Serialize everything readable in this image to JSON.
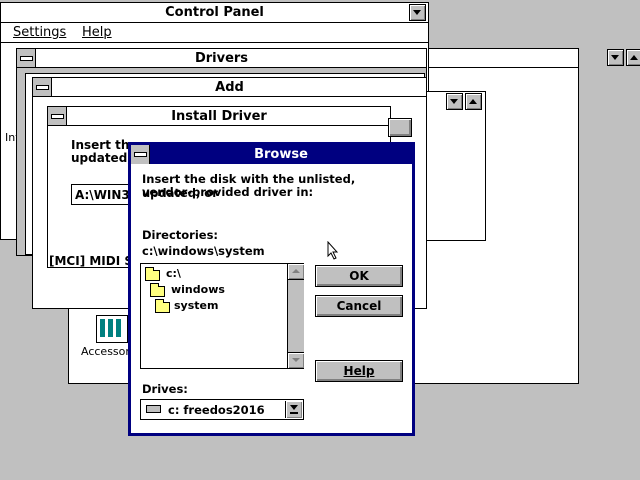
{
  "control_panel": {
    "title": "Control Panel",
    "menu": [
      "Settings",
      "Help"
    ],
    "icon_label": "Accessori",
    "left_fragment": "Int"
  },
  "drivers": {
    "title": "Drivers"
  },
  "add": {
    "title": "Add"
  },
  "install_driver": {
    "title": "Install Driver",
    "text_line1": "Insert the",
    "text_line2": "updated, o",
    "path_value": "A:\\WIN31",
    "list_fragment": "[MCI] MIDI Se"
  },
  "browse": {
    "title": "Browse",
    "instruction_line1": "Insert the disk with the unlisted, updated, or",
    "instruction_line2": "vendor-provided driver in:",
    "directories_label": "Directories:",
    "current_dir": "c:\\windows\\system",
    "directories": [
      {
        "name": "c:\\",
        "icon": "open-folder-icon"
      },
      {
        "name": "windows",
        "icon": "open-folder-icon"
      },
      {
        "name": "system",
        "icon": "open-folder-icon"
      }
    ],
    "drives_label": "Drives:",
    "drive_value": "c: freedos2016",
    "ok_label": "OK",
    "cancel_label": "Cancel",
    "help_label": "Help"
  },
  "colors": {
    "desktop": "#c0c0c0",
    "active_title": "#000080",
    "window": "#ffffff",
    "face": "#c0c0c0"
  }
}
